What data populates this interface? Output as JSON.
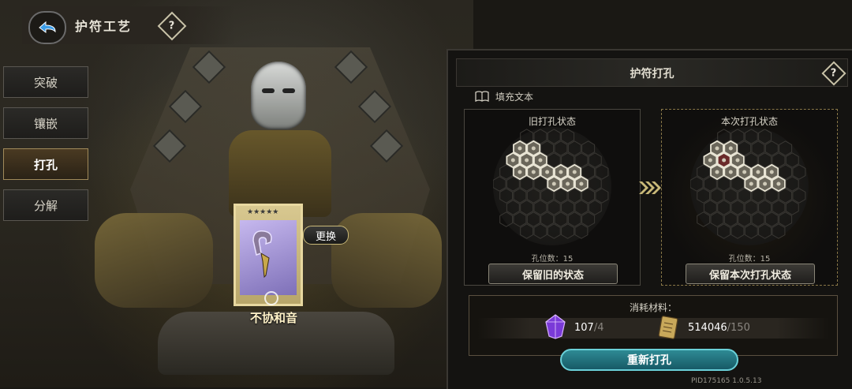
{
  "header": {
    "title": "护符工艺",
    "help_glyph": "?"
  },
  "sidebar": {
    "items": [
      {
        "label": "突破",
        "active": false
      },
      {
        "label": "镶嵌",
        "active": false
      },
      {
        "label": "打孔",
        "active": true
      },
      {
        "label": "分解",
        "active": false
      }
    ]
  },
  "card": {
    "name": "不协和音",
    "swap_label": "更换",
    "stars": "★★★★★"
  },
  "panel": {
    "title": "护符打孔",
    "help_glyph": "?",
    "fill_text": "填充文本",
    "old_state": {
      "label": "旧打孔状态",
      "hole_count": "孔位数：15",
      "button": "保留旧的状态"
    },
    "new_state": {
      "label": "本次打孔状态",
      "hole_count": "孔位数：15",
      "button": "保留本次打孔状态"
    },
    "cost": {
      "title": "消耗材料：",
      "mat1_have": "107",
      "mat1_need": "/4",
      "mat2_have": "514046",
      "mat2_need": "/150"
    },
    "reroll_button": "重新打孔"
  },
  "version": "PID175165  1.0.5.13",
  "colors": {
    "accent_teal": "#2e8a94",
    "gold": "#c8b878"
  }
}
